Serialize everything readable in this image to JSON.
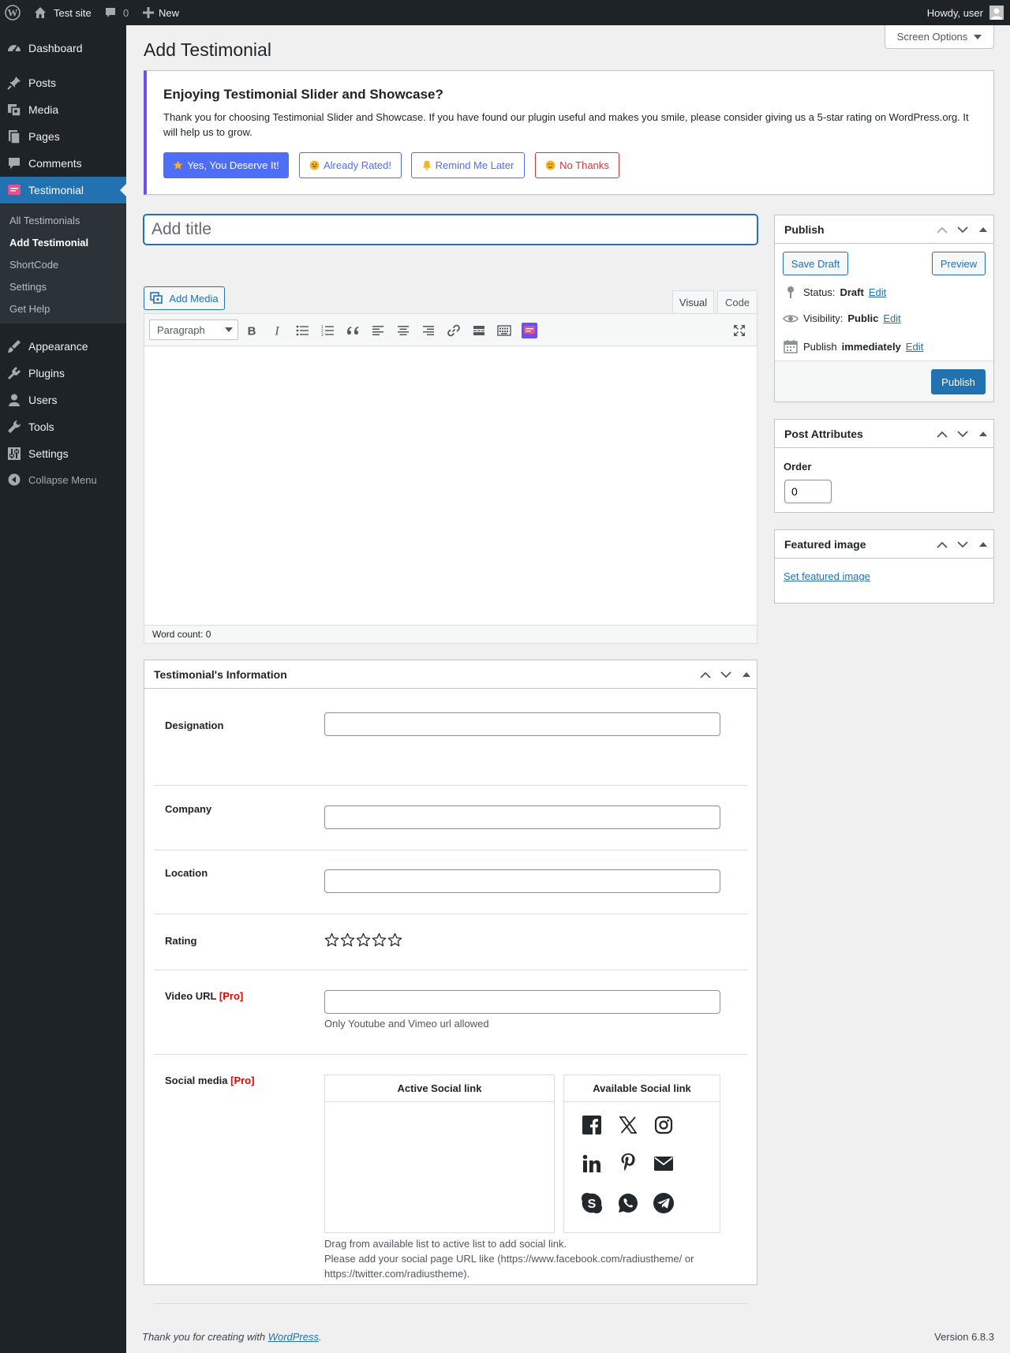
{
  "admin_bar": {
    "site_name": "Test site",
    "comments_count": "0",
    "new_label": "New",
    "howdy": "Howdy, user"
  },
  "sidebar": {
    "items": [
      {
        "label": "Dashboard",
        "icon": "dashboard-icon"
      },
      {
        "label": "Posts",
        "icon": "pin-icon"
      },
      {
        "label": "Media",
        "icon": "media-icon"
      },
      {
        "label": "Pages",
        "icon": "pages-icon"
      },
      {
        "label": "Comments",
        "icon": "comment-icon"
      },
      {
        "label": "Testimonial",
        "icon": "testimonial-icon",
        "current": true
      },
      {
        "label": "Appearance",
        "icon": "brush-icon"
      },
      {
        "label": "Plugins",
        "icon": "plugin-icon"
      },
      {
        "label": "Users",
        "icon": "user-icon"
      },
      {
        "label": "Tools",
        "icon": "wrench-icon"
      },
      {
        "label": "Settings",
        "icon": "settings-icon"
      }
    ],
    "submenu": [
      "All Testimonials",
      "Add Testimonial",
      "ShortCode",
      "Settings",
      "Get Help"
    ],
    "collapse_label": "Collapse Menu"
  },
  "header": {
    "title": "Add Testimonial",
    "screen_options": "Screen Options"
  },
  "notice": {
    "title": "Enjoying Testimonial Slider and Showcase?",
    "text": "Thank you for choosing Testimonial Slider and Showcase. If you have found our plugin useful and makes you smile, please consider giving us a 5-star rating on WordPress.org. It will help us to grow.",
    "buttons": {
      "rate": "Yes, You Deserve It!",
      "rated": "Already Rated!",
      "remind": "Remind Me Later",
      "no": "No Thanks"
    },
    "accent": "#6d4ef0"
  },
  "title_field": {
    "placeholder": "Add title",
    "value": ""
  },
  "editor": {
    "add_media": "Add Media",
    "tab_visual": "Visual",
    "tab_code": "Code",
    "format": "Paragraph",
    "word_count": "Word count: 0"
  },
  "info_box": {
    "title": "Testimonial's Information",
    "designation_label": "Designation",
    "company_label": "Company",
    "location_label": "Location",
    "rating_label": "Rating",
    "rating_value": 0,
    "rating_max": 5,
    "video_label": "Video URL",
    "pro_tag": "[Pro]",
    "video_help": "Only Youtube and Vimeo url allowed",
    "social_label": "Social media",
    "active_social_title": "Active Social link",
    "available_social_title": "Available Social link",
    "social_icons": [
      "facebook-icon",
      "x-icon",
      "instagram-icon",
      "linkedin-icon",
      "pinterest-icon",
      "email-icon",
      "skype-icon",
      "whatsapp-icon",
      "telegram-icon"
    ],
    "social_help_1": "Drag from available list to active list to add social link.",
    "social_help_2": "Please add your social page URL like (https://www.facebook.com/radiustheme/ or https://twitter.com/radiustheme)."
  },
  "publish": {
    "title": "Publish",
    "save_draft": "Save Draft",
    "preview": "Preview",
    "status_label": "Status:",
    "status_value": "Draft",
    "visibility_label": "Visibility:",
    "visibility_value": "Public",
    "publish_label": "Publish",
    "publish_value": "immediately",
    "edit": "Edit",
    "publish_button": "Publish"
  },
  "post_attributes": {
    "title": "Post Attributes",
    "order_label": "Order",
    "order_value": "0"
  },
  "featured_image": {
    "title": "Featured image",
    "link": "Set featured image"
  },
  "footer": {
    "thanks_prefix": "Thank you for creating with ",
    "wordpress": "WordPress",
    "thanks_suffix": ".",
    "version": "Version 6.8.3"
  },
  "colors": {
    "admin_dark": "#1d2327",
    "primary": "#2271b1",
    "notice_button": "#4f6ef7",
    "danger": "#d63638"
  }
}
